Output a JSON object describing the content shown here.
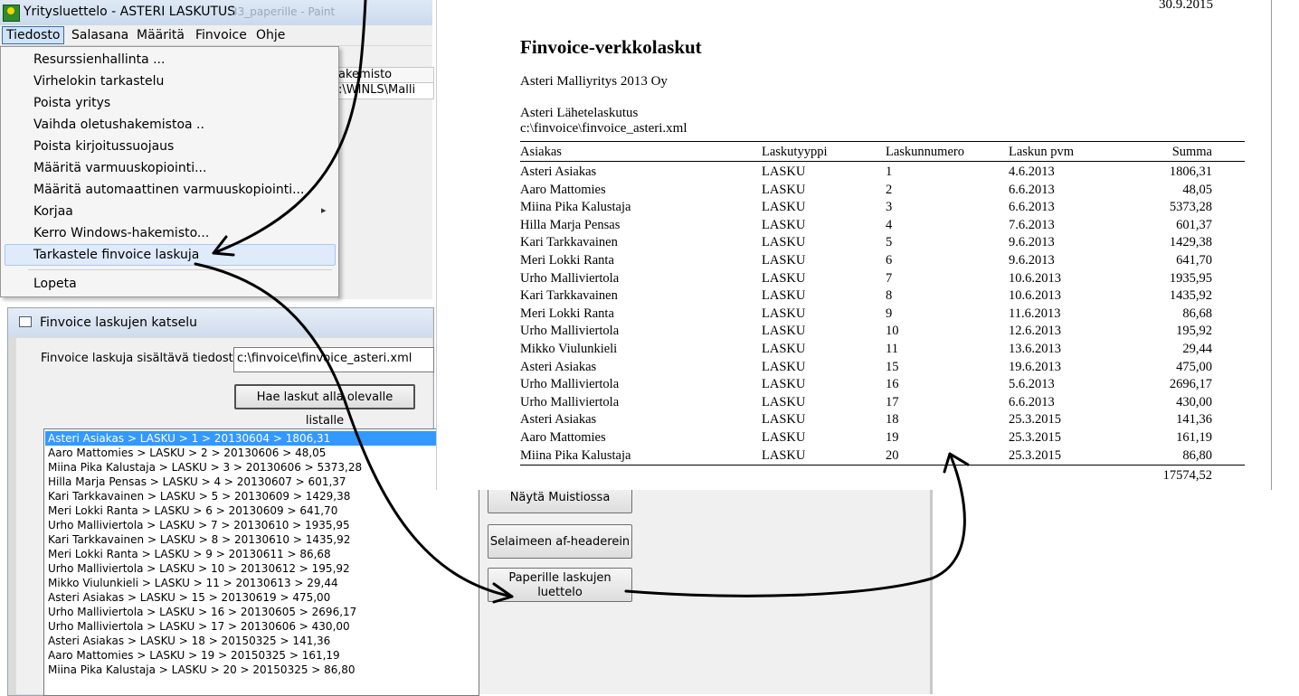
{
  "window": {
    "title": "Yritysluettelo - ASTERI LASKUTUS",
    "ghost_title": "33_paperille - Paint"
  },
  "menubar": {
    "items": [
      "Tiedosto",
      "Salasana",
      "Määritä",
      "Finvoice",
      "Ohje"
    ]
  },
  "file_menu": {
    "items": [
      "Resurssienhallinta ...",
      "Virhelokin tarkastelu",
      "Poista yritys",
      "Vaihda oletushakemistoa ..",
      "Poista kirjoitussuojaus",
      "Määritä varmuuskopiointi...",
      "Määritä automaattinen varmuuskopiointi...",
      "Korjaa",
      "Kerro Windows-hakemisto...",
      "Tarkastele finvoice laskuja",
      "Lopeta"
    ],
    "submenu_arrow": "▸"
  },
  "background_grid": {
    "header": "akemisto",
    "value": ":\\WINLS\\Malli"
  },
  "finvoice_window": {
    "title": "Finvoice laskujen katselu",
    "file_label": "Finvoice laskuja sisältävä tiedosto",
    "file_value": "c:\\finvoice\\finvoice_asteri.xml",
    "fetch_button": "Hae laskut alla olevalle listalle",
    "list": [
      "Asteri Asiakas > LASKU > 1 > 20130604 > 1806,31",
      "Aaro Mattomies > LASKU > 2 > 20130606 > 48,05",
      "Miina Pika Kalustaja > LASKU > 3 > 20130606 > 5373,28",
      "Hilla Marja Pensas > LASKU > 4 > 20130607 > 601,37",
      "Kari Tarkkavainen > LASKU > 5 > 20130609 > 1429,38",
      "Meri Lokki Ranta > LASKU > 6 > 20130609 > 641,70",
      "Urho Malliviertola > LASKU > 7 > 20130610 > 1935,95",
      "Kari Tarkkavainen > LASKU > 8 > 20130610 > 1435,92",
      "Meri Lokki Ranta > LASKU > 9 > 20130611 > 86,68",
      "Urho Malliviertola > LASKU > 10 > 20130612 > 195,92",
      "Mikko Viulunkieli > LASKU > 11 > 20130613 > 29,44",
      "Asteri Asiakas > LASKU > 15 > 20130619 > 475,00",
      "Urho Malliviertola > LASKU > 16 > 20130605 > 2696,17",
      "Urho Malliviertola > LASKU > 17 > 20130606 > 430,00",
      "Asteri Asiakas > LASKU > 18 > 20150325 > 141,36",
      "Aaro Mattomies > LASKU > 19 > 20150325 > 161,19",
      "Miina Pika Kalustaja > LASKU > 20 > 20150325 > 86,80"
    ],
    "buttons": {
      "notepad": "Näytä Muistiossa",
      "browser": "Selaimeen af-headerein",
      "paper_line1": "Paperille laskujen",
      "paper_line2": "luettelo"
    }
  },
  "report": {
    "date": "30.9.2015",
    "title": "Finvoice-verkkolaskut",
    "company": "Asteri Malliyritys 2013 Oy",
    "source_line1": "Asteri Lähetelaskutus",
    "source_line2": "c:\\finvoice\\finvoice_asteri.xml",
    "columns": [
      "Asiakas",
      "Laskutyyppi",
      "Laskunnumero",
      "Laskun pvm",
      "Summa"
    ],
    "rows": [
      [
        "Asteri Asiakas",
        "LASKU",
        "1",
        "4.6.2013",
        "1806,31"
      ],
      [
        "Aaro Mattomies",
        "LASKU",
        "2",
        "6.6.2013",
        "48,05"
      ],
      [
        "Miina Pika Kalustaja",
        "LASKU",
        "3",
        "6.6.2013",
        "5373,28"
      ],
      [
        "Hilla Marja Pensas",
        "LASKU",
        "4",
        "7.6.2013",
        "601,37"
      ],
      [
        "Kari Tarkkavainen",
        "LASKU",
        "5",
        "9.6.2013",
        "1429,38"
      ],
      [
        "Meri Lokki Ranta",
        "LASKU",
        "6",
        "9.6.2013",
        "641,70"
      ],
      [
        "Urho Malliviertola",
        "LASKU",
        "7",
        "10.6.2013",
        "1935,95"
      ],
      [
        "Kari Tarkkavainen",
        "LASKU",
        "8",
        "10.6.2013",
        "1435,92"
      ],
      [
        "Meri Lokki Ranta",
        "LASKU",
        "9",
        "11.6.2013",
        "86,68"
      ],
      [
        "Urho Malliviertola",
        "LASKU",
        "10",
        "12.6.2013",
        "195,92"
      ],
      [
        "Mikko Viulunkieli",
        "LASKU",
        "11",
        "13.6.2013",
        "29,44"
      ],
      [
        "Asteri Asiakas",
        "LASKU",
        "15",
        "19.6.2013",
        "475,00"
      ],
      [
        "Urho Malliviertola",
        "LASKU",
        "16",
        "5.6.2013",
        "2696,17"
      ],
      [
        "Urho Malliviertola",
        "LASKU",
        "17",
        "6.6.2013",
        "430,00"
      ],
      [
        "Asteri Asiakas",
        "LASKU",
        "18",
        "25.3.2015",
        "141,36"
      ],
      [
        "Aaro Mattomies",
        "LASKU",
        "19",
        "25.3.2015",
        "161,19"
      ],
      [
        "Miina Pika Kalustaja",
        "LASKU",
        "20",
        "25.3.2015",
        "86,80"
      ]
    ],
    "total": "17574,52"
  },
  "colors": {
    "selection": "#3399ff",
    "menu_highlight": "#dfeafa"
  }
}
